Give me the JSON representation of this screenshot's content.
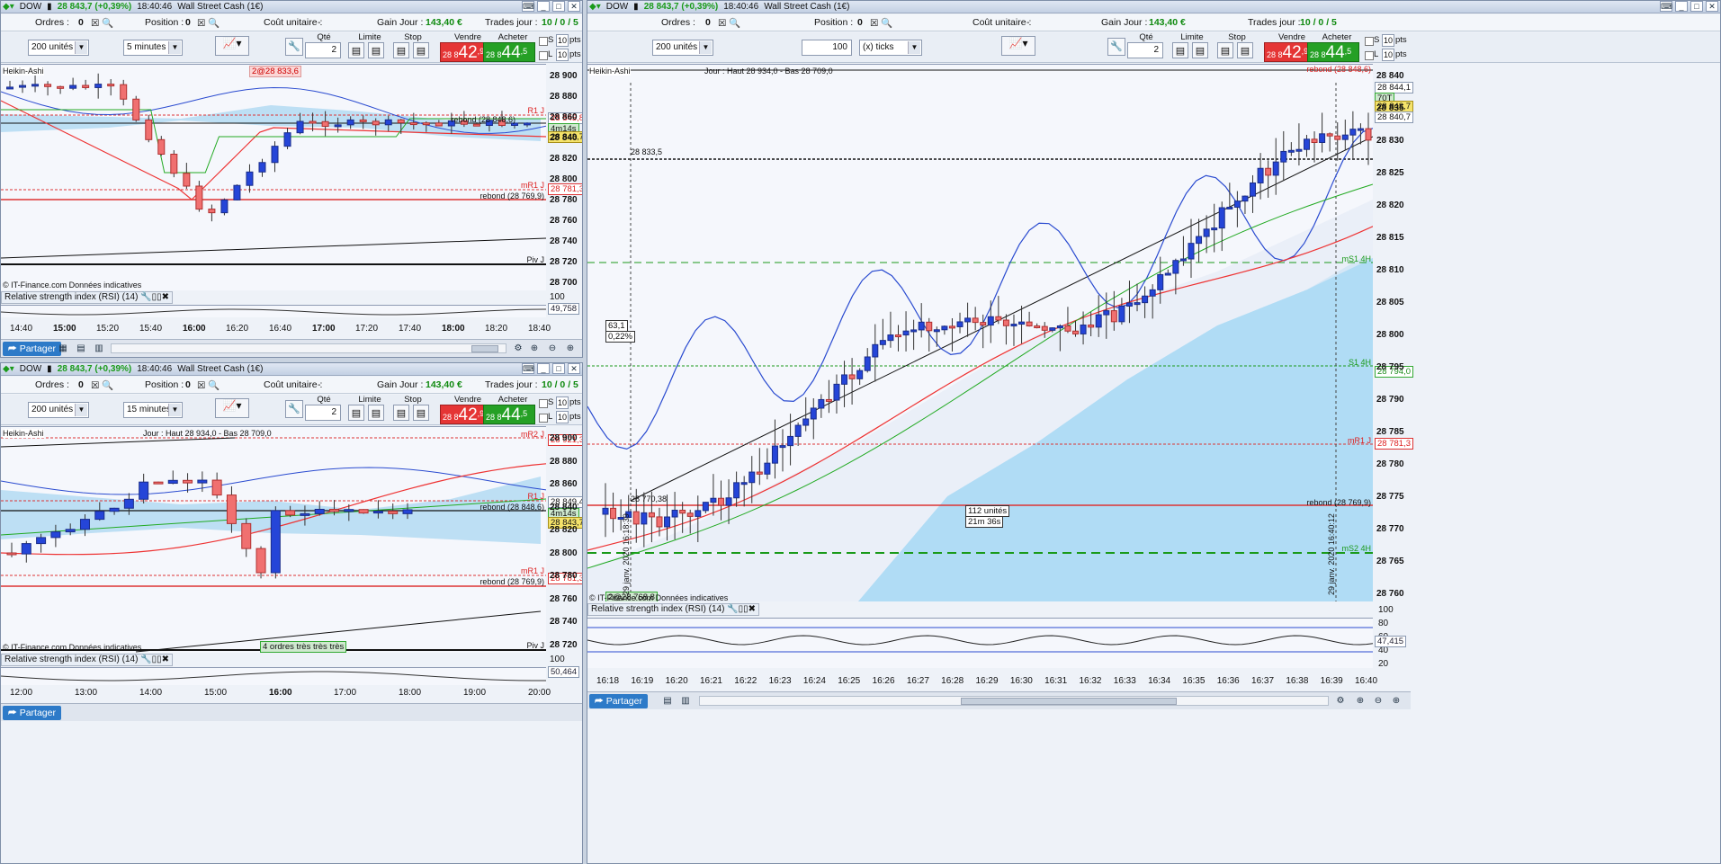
{
  "app": {
    "symbol": "DOW",
    "last": "28 843,7 (+0,39%)",
    "time": "18:40:46",
    "instrument": "Wall Street Cash (1€)"
  },
  "status": {
    "orders_label": "Ordres :",
    "orders_value": "0",
    "position_label": "Position :",
    "position_value": "0",
    "cost_label": "Coût unitaire :",
    "cost_value": "-",
    "gain_label": "Gain Jour :",
    "gain_value": "143,40 €",
    "trades_label": "Trades jour :",
    "trades_value": "10 / 0 / 5"
  },
  "controls": {
    "units": "200 unités",
    "tf1": "5 minutes",
    "tf2": "15 minutes",
    "ticks_value": "100",
    "ticks_unit": "(x) ticks",
    "qty_label": "Qté",
    "qty_value": "2",
    "limit_label": "Limite",
    "stop_label": "Stop",
    "sell_label": "Vendre",
    "buy_label": "Acheter",
    "sell_small": "28 8",
    "sell_big": "42",
    "sell_sup": ",9",
    "buy_small": "28 8",
    "buy_big": "44",
    "buy_sup": ",5",
    "s_label": "S",
    "l_label": "L",
    "pts_value": "10",
    "pts_unit": "pts"
  },
  "chart_common": {
    "style": "Heikin-Ashi",
    "rsi_label": "Relative strength index (RSI) (14)",
    "copyright": "© IT-Finance.com  Données indicatives",
    "share": "Partager"
  },
  "chart1": {
    "yticks": [
      "28 900",
      "28 880",
      "28 860",
      "28 840",
      "28 820",
      "28 800",
      "28 780",
      "28 760",
      "28 740",
      "28 720",
      "28 700"
    ],
    "xticks": [
      "14:40",
      "15:00",
      "15:20",
      "15:40",
      "16:00",
      "16:20",
      "16:40",
      "17:00",
      "17:20",
      "17:40",
      "18:00",
      "18:20",
      "18:40"
    ],
    "bold_ticks": [
      "15:00",
      "16:00",
      "17:00",
      "18:00"
    ],
    "tags": {
      "price": "28 843,7",
      "timer": "4m14s",
      "rebound_hi": "28 845,8",
      "mR1": "28 781,3",
      "rsi": "49,758"
    },
    "labels": {
      "r1": "R1 J",
      "rebond_hi": "rebond (28 848,6)",
      "mr1": "mR1 J",
      "rebond_lo": "rebond (28 769,9)",
      "piv": "Piv J",
      "orders": "2@28 833,6",
      "rsi_top": "100"
    }
  },
  "chart2": {
    "yticks": [
      "28 900",
      "28 880",
      "28 860",
      "28 840",
      "28 820",
      "28 800",
      "28 780",
      "28 760",
      "28 740",
      "28 720"
    ],
    "xticks": [
      "12:00",
      "13:00",
      "14:00",
      "15:00",
      "16:00",
      "17:00",
      "18:00",
      "19:00",
      "20:00"
    ],
    "bold_ticks": [
      "16:00"
    ],
    "tags": {
      "mR2": "28 921,3",
      "price": "28 843,7",
      "timer": "4m14s",
      "rebound_hi": "28 849,4",
      "mR1": "28 781,3",
      "rsi": "50,464"
    },
    "labels": {
      "jour": "Jour : Haut 28 934,0 - Bas 28 709,0",
      "mr2": "mR2 J",
      "r1": "R1 J",
      "rebond_hi": "rebond (28 848,6)",
      "mr1": "mR1 J",
      "rebond_lo": "rebond (28 769,9)",
      "piv": "Piv J",
      "orders": "4 ordres très très très",
      "rsi_top": "100"
    }
  },
  "chart3": {
    "yticks": [
      "28 840",
      "28 835",
      "28 830",
      "28 825",
      "28 820",
      "28 815",
      "28 810",
      "28 805",
      "28 800",
      "28 795",
      "28 790",
      "28 785",
      "28 780",
      "28 775",
      "28 770",
      "28 765",
      "28 760"
    ],
    "xticks": [
      "16:18",
      "16:19",
      "16:20",
      "16:21",
      "16:22",
      "16:23",
      "16:24",
      "16:25",
      "16:26",
      "16:27",
      "16:28",
      "16:29",
      "16:30",
      "16:31",
      "16:32",
      "16:33",
      "16:34",
      "16:35",
      "16:36",
      "16:37",
      "16:38",
      "16:39",
      "16:40"
    ],
    "tags": {
      "p1": "28 844,1",
      "timer": "70T",
      "price": "28 843,7",
      "p2": "28 840,7",
      "s1": "28 794,0",
      "mR1": "28 781,3",
      "rsi": "47,415"
    },
    "labels": {
      "jour": "Jour : Haut 28 934,0 - Bas 28 709,0",
      "hline": "28 833,5",
      "ms14h": "mS1 4H",
      "s14h": "S1 4H",
      "mr1": "mR1 J",
      "rebond_lo": "rebond (28 769,9)",
      "ms24h": "mS2 4H",
      "rebond_hi": "rebond (28 848,6)",
      "range1": "63,1",
      "range2": "0,22%",
      "info1": "112 unités",
      "info2": "21m 36s",
      "vdate1": "29 janv. 2020 16:18:39",
      "vdate2": "29 janv. 2020 16:40:12",
      "order": "2@28 768,8",
      "start": "28 770,38",
      "rsi_ticks": [
        "100",
        "80",
        "60",
        "40",
        "20"
      ]
    }
  }
}
